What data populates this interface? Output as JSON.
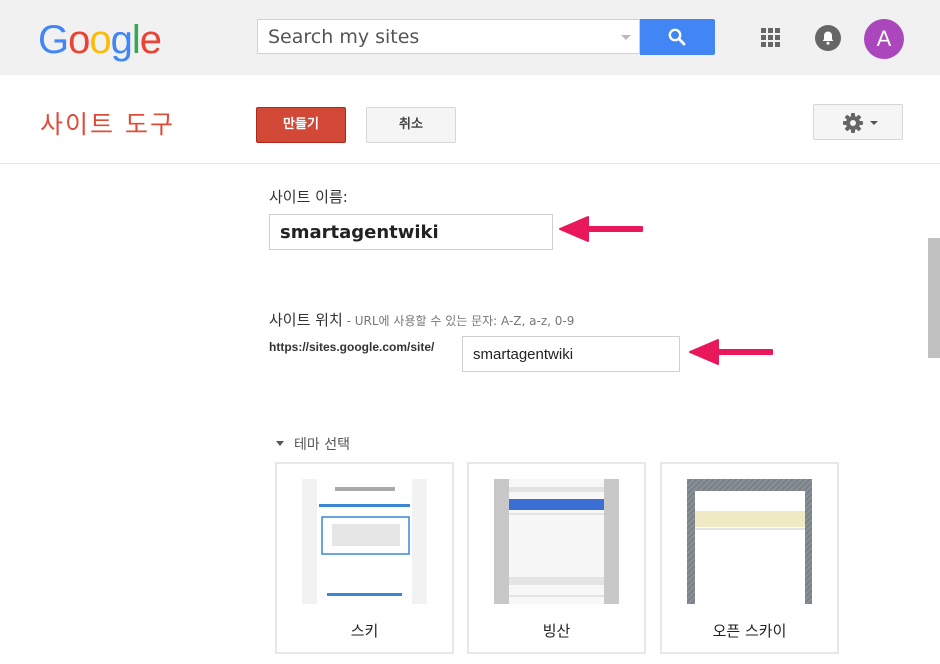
{
  "topbar": {
    "logo_letters": [
      {
        "ch": "G",
        "color": "#4285f4"
      },
      {
        "ch": "o",
        "color": "#ea4335"
      },
      {
        "ch": "o",
        "color": "#fbbc05"
      },
      {
        "ch": "g",
        "color": "#4285f4"
      },
      {
        "ch": "l",
        "color": "#34a853"
      },
      {
        "ch": "e",
        "color": "#ea4335"
      }
    ],
    "search_placeholder": "Search my sites",
    "avatar_letter": "A"
  },
  "header": {
    "title": "사이트 도구",
    "create_label": "만들기",
    "cancel_label": "취소"
  },
  "form": {
    "site_name_label": "사이트 이름:",
    "site_name_value": "smartagentwiki",
    "site_location_label": "사이트 위치",
    "site_location_hint": " - URL에 사용할 수 있는 문자: A-Z, a-z, 0-9",
    "url_prefix": "https://sites.google.com/site/",
    "site_location_value": "smartagentwiki"
  },
  "themes": {
    "toggle_label": "테마 선택",
    "items": [
      {
        "name": "스키"
      },
      {
        "name": "빙산"
      },
      {
        "name": "오픈 스카이"
      }
    ]
  },
  "colors": {
    "brand_red": "#dd4b39",
    "create_button": "#d14836",
    "search_button": "#4285f4",
    "avatar": "#ab47bc",
    "arrow": "#e8185a"
  },
  "icons": [
    "search-icon",
    "apps-grid-icon",
    "bell-icon",
    "gear-icon",
    "chevron-down-icon"
  ]
}
